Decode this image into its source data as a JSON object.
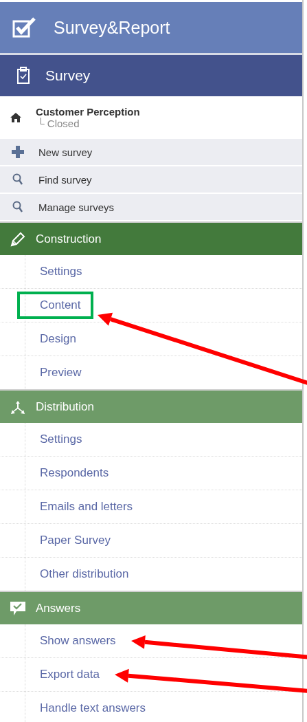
{
  "app": {
    "title": "Survey&Report"
  },
  "module": {
    "title": "Survey"
  },
  "current_survey": {
    "name": "Customer Perception",
    "status": "└ Closed"
  },
  "actions": [
    {
      "kind": "add",
      "label": "New survey"
    },
    {
      "kind": "search",
      "label": "Find survey"
    },
    {
      "kind": "search",
      "label": "Manage surveys"
    }
  ],
  "sections": [
    {
      "title": "Construction",
      "active": true,
      "items": [
        {
          "label": "Settings",
          "highlighted": false,
          "arrow": false
        },
        {
          "label": "Content",
          "highlighted": true,
          "arrow": true
        },
        {
          "label": "Design",
          "highlighted": false,
          "arrow": false
        },
        {
          "label": "Preview",
          "highlighted": false,
          "arrow": false
        }
      ]
    },
    {
      "title": "Distribution",
      "active": false,
      "items": [
        {
          "label": "Settings",
          "highlighted": false,
          "arrow": false
        },
        {
          "label": "Respondents",
          "highlighted": false,
          "arrow": false
        },
        {
          "label": "Emails and letters",
          "highlighted": false,
          "arrow": false
        },
        {
          "label": "Paper Survey",
          "highlighted": false,
          "arrow": false
        },
        {
          "label": "Other distribution",
          "highlighted": false,
          "arrow": false
        }
      ]
    },
    {
      "title": "Answers",
      "active": false,
      "items": [
        {
          "label": "Show answers",
          "highlighted": false,
          "arrow": true
        },
        {
          "label": "Export data",
          "highlighted": false,
          "arrow": true
        },
        {
          "label": "Handle text answers",
          "highlighted": false,
          "arrow": false
        }
      ]
    }
  ]
}
